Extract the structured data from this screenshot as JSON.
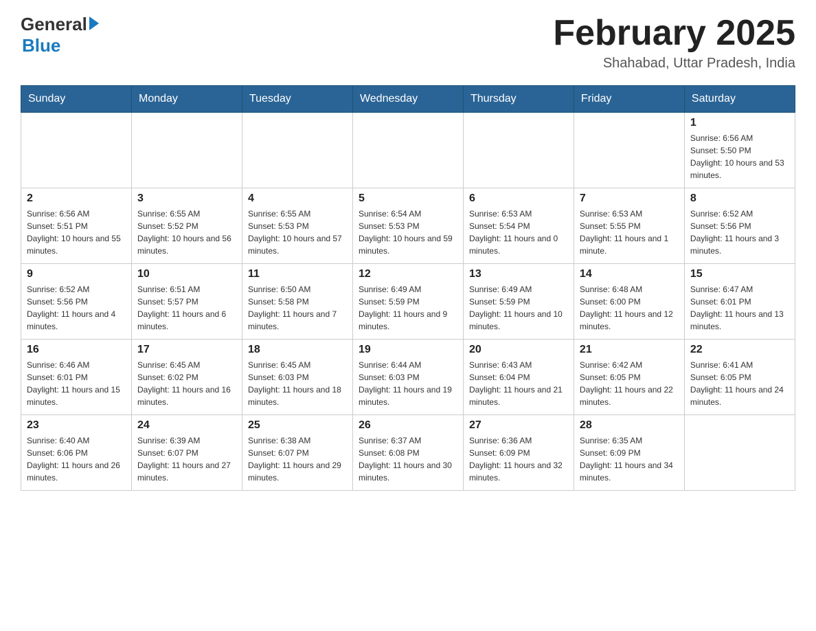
{
  "header": {
    "logo_general": "General",
    "logo_blue": "Blue",
    "title": "February 2025",
    "subtitle": "Shahabad, Uttar Pradesh, India"
  },
  "weekdays": [
    "Sunday",
    "Monday",
    "Tuesday",
    "Wednesday",
    "Thursday",
    "Friday",
    "Saturday"
  ],
  "weeks": [
    [
      {
        "day": "",
        "sunrise": "",
        "sunset": "",
        "daylight": ""
      },
      {
        "day": "",
        "sunrise": "",
        "sunset": "",
        "daylight": ""
      },
      {
        "day": "",
        "sunrise": "",
        "sunset": "",
        "daylight": ""
      },
      {
        "day": "",
        "sunrise": "",
        "sunset": "",
        "daylight": ""
      },
      {
        "day": "",
        "sunrise": "",
        "sunset": "",
        "daylight": ""
      },
      {
        "day": "",
        "sunrise": "",
        "sunset": "",
        "daylight": ""
      },
      {
        "day": "1",
        "sunrise": "Sunrise: 6:56 AM",
        "sunset": "Sunset: 5:50 PM",
        "daylight": "Daylight: 10 hours and 53 minutes."
      }
    ],
    [
      {
        "day": "2",
        "sunrise": "Sunrise: 6:56 AM",
        "sunset": "Sunset: 5:51 PM",
        "daylight": "Daylight: 10 hours and 55 minutes."
      },
      {
        "day": "3",
        "sunrise": "Sunrise: 6:55 AM",
        "sunset": "Sunset: 5:52 PM",
        "daylight": "Daylight: 10 hours and 56 minutes."
      },
      {
        "day": "4",
        "sunrise": "Sunrise: 6:55 AM",
        "sunset": "Sunset: 5:53 PM",
        "daylight": "Daylight: 10 hours and 57 minutes."
      },
      {
        "day": "5",
        "sunrise": "Sunrise: 6:54 AM",
        "sunset": "Sunset: 5:53 PM",
        "daylight": "Daylight: 10 hours and 59 minutes."
      },
      {
        "day": "6",
        "sunrise": "Sunrise: 6:53 AM",
        "sunset": "Sunset: 5:54 PM",
        "daylight": "Daylight: 11 hours and 0 minutes."
      },
      {
        "day": "7",
        "sunrise": "Sunrise: 6:53 AM",
        "sunset": "Sunset: 5:55 PM",
        "daylight": "Daylight: 11 hours and 1 minute."
      },
      {
        "day": "8",
        "sunrise": "Sunrise: 6:52 AM",
        "sunset": "Sunset: 5:56 PM",
        "daylight": "Daylight: 11 hours and 3 minutes."
      }
    ],
    [
      {
        "day": "9",
        "sunrise": "Sunrise: 6:52 AM",
        "sunset": "Sunset: 5:56 PM",
        "daylight": "Daylight: 11 hours and 4 minutes."
      },
      {
        "day": "10",
        "sunrise": "Sunrise: 6:51 AM",
        "sunset": "Sunset: 5:57 PM",
        "daylight": "Daylight: 11 hours and 6 minutes."
      },
      {
        "day": "11",
        "sunrise": "Sunrise: 6:50 AM",
        "sunset": "Sunset: 5:58 PM",
        "daylight": "Daylight: 11 hours and 7 minutes."
      },
      {
        "day": "12",
        "sunrise": "Sunrise: 6:49 AM",
        "sunset": "Sunset: 5:59 PM",
        "daylight": "Daylight: 11 hours and 9 minutes."
      },
      {
        "day": "13",
        "sunrise": "Sunrise: 6:49 AM",
        "sunset": "Sunset: 5:59 PM",
        "daylight": "Daylight: 11 hours and 10 minutes."
      },
      {
        "day": "14",
        "sunrise": "Sunrise: 6:48 AM",
        "sunset": "Sunset: 6:00 PM",
        "daylight": "Daylight: 11 hours and 12 minutes."
      },
      {
        "day": "15",
        "sunrise": "Sunrise: 6:47 AM",
        "sunset": "Sunset: 6:01 PM",
        "daylight": "Daylight: 11 hours and 13 minutes."
      }
    ],
    [
      {
        "day": "16",
        "sunrise": "Sunrise: 6:46 AM",
        "sunset": "Sunset: 6:01 PM",
        "daylight": "Daylight: 11 hours and 15 minutes."
      },
      {
        "day": "17",
        "sunrise": "Sunrise: 6:45 AM",
        "sunset": "Sunset: 6:02 PM",
        "daylight": "Daylight: 11 hours and 16 minutes."
      },
      {
        "day": "18",
        "sunrise": "Sunrise: 6:45 AM",
        "sunset": "Sunset: 6:03 PM",
        "daylight": "Daylight: 11 hours and 18 minutes."
      },
      {
        "day": "19",
        "sunrise": "Sunrise: 6:44 AM",
        "sunset": "Sunset: 6:03 PM",
        "daylight": "Daylight: 11 hours and 19 minutes."
      },
      {
        "day": "20",
        "sunrise": "Sunrise: 6:43 AM",
        "sunset": "Sunset: 6:04 PM",
        "daylight": "Daylight: 11 hours and 21 minutes."
      },
      {
        "day": "21",
        "sunrise": "Sunrise: 6:42 AM",
        "sunset": "Sunset: 6:05 PM",
        "daylight": "Daylight: 11 hours and 22 minutes."
      },
      {
        "day": "22",
        "sunrise": "Sunrise: 6:41 AM",
        "sunset": "Sunset: 6:05 PM",
        "daylight": "Daylight: 11 hours and 24 minutes."
      }
    ],
    [
      {
        "day": "23",
        "sunrise": "Sunrise: 6:40 AM",
        "sunset": "Sunset: 6:06 PM",
        "daylight": "Daylight: 11 hours and 26 minutes."
      },
      {
        "day": "24",
        "sunrise": "Sunrise: 6:39 AM",
        "sunset": "Sunset: 6:07 PM",
        "daylight": "Daylight: 11 hours and 27 minutes."
      },
      {
        "day": "25",
        "sunrise": "Sunrise: 6:38 AM",
        "sunset": "Sunset: 6:07 PM",
        "daylight": "Daylight: 11 hours and 29 minutes."
      },
      {
        "day": "26",
        "sunrise": "Sunrise: 6:37 AM",
        "sunset": "Sunset: 6:08 PM",
        "daylight": "Daylight: 11 hours and 30 minutes."
      },
      {
        "day": "27",
        "sunrise": "Sunrise: 6:36 AM",
        "sunset": "Sunset: 6:09 PM",
        "daylight": "Daylight: 11 hours and 32 minutes."
      },
      {
        "day": "28",
        "sunrise": "Sunrise: 6:35 AM",
        "sunset": "Sunset: 6:09 PM",
        "daylight": "Daylight: 11 hours and 34 minutes."
      },
      {
        "day": "",
        "sunrise": "",
        "sunset": "",
        "daylight": ""
      }
    ]
  ]
}
